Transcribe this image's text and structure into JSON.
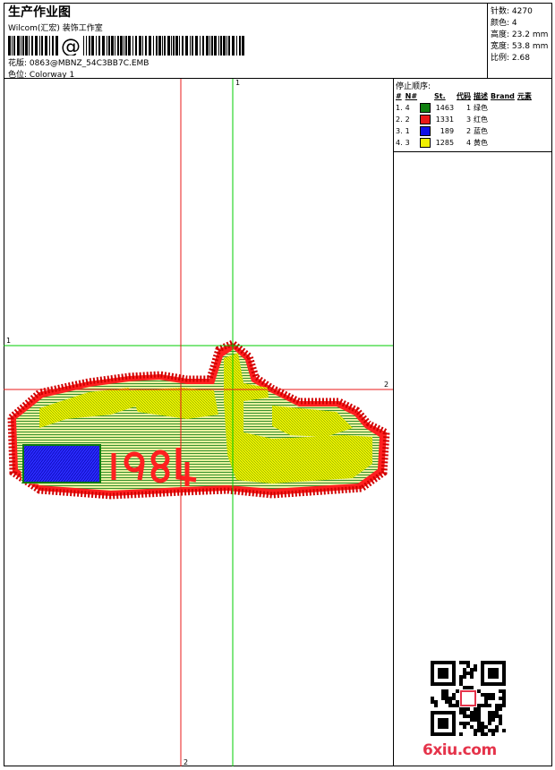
{
  "header": {
    "title": "生产作业图",
    "subtitle": "Wilcom(汇宏) 装饰工作室",
    "barcode_text": "@",
    "design_label": "花版:",
    "design_value": "0863@MBNZ_54C3BB7C.EMB",
    "colorway_label": "色位:",
    "colorway_value": "Colorway 1"
  },
  "stats": [
    {
      "label": "针数:",
      "value": "4270"
    },
    {
      "label": "颜色:",
      "value": "4"
    },
    {
      "label": "高度:",
      "value": "23.2 mm"
    },
    {
      "label": "宽度:",
      "value": "53.8 mm"
    },
    {
      "label": "比例:",
      "value": "2.68"
    }
  ],
  "guides": {
    "v1": "1",
    "h1": "1",
    "h2": "2",
    "v2": "2"
  },
  "stop_sequence": {
    "title": "停止顺序:",
    "columns": [
      "#",
      "N#",
      "St.",
      "代码",
      "描述",
      "Brand",
      "元素"
    ],
    "rows": [
      {
        "idx": "1.",
        "n": "4",
        "color": "#108010",
        "st": "1463",
        "code": "1",
        "desc": "绿色"
      },
      {
        "idx": "2.",
        "n": "2",
        "color": "#e81818",
        "st": "1331",
        "code": "3",
        "desc": "红色"
      },
      {
        "idx": "3.",
        "n": "1",
        "color": "#1010e8",
        "st": "189",
        "code": "2",
        "desc": "蓝色"
      },
      {
        "idx": "4.",
        "n": "3",
        "color": "#f0f000",
        "st": "1285",
        "code": "4",
        "desc": "黄色"
      }
    ]
  },
  "watermark": "6xiu.com"
}
